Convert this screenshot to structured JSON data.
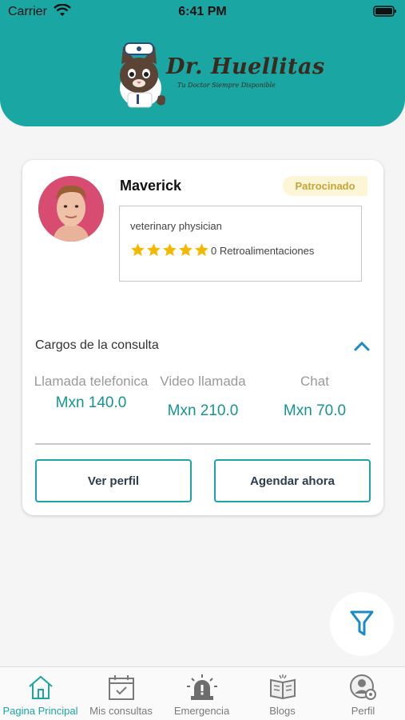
{
  "status_bar": {
    "carrier": "Carrier",
    "time": "6:41 PM"
  },
  "brand": {
    "name": "Dr. Huellitas",
    "tagline": "Tu Doctor Siempre Disponible"
  },
  "doctor": {
    "name": "Maverick",
    "badge": "Patrocinado",
    "specialty": "veterinary physician",
    "rating": 5,
    "feedback": "0 Retroalimentaciones"
  },
  "consultation": {
    "title": "Cargos de la consulta",
    "fees": [
      {
        "label": "Llamada telefonica",
        "price": "Mxn 140.0"
      },
      {
        "label": "Video llamada",
        "price": "Mxn 210.0"
      },
      {
        "label": "Chat",
        "price": "Mxn 70.0"
      }
    ]
  },
  "actions": {
    "view_profile": "Ver perfil",
    "schedule": "Agendar ahora"
  },
  "tabs": [
    {
      "label": "Pagina Principal",
      "icon": "home-icon",
      "active": true
    },
    {
      "label": "Mis consultas",
      "icon": "calendar-check-icon",
      "active": false
    },
    {
      "label": "Emergencia",
      "icon": "siren-icon",
      "active": false
    },
    {
      "label": "Blogs",
      "icon": "book-icon",
      "active": false
    },
    {
      "label": "Perfil",
      "icon": "user-settings-icon",
      "active": false
    }
  ],
  "colors": {
    "primary": "#1aa6a3",
    "badge_bg": "#fdf6d6",
    "badge_text": "#c7a53a",
    "star": "#f5b800",
    "price": "#16958f"
  }
}
